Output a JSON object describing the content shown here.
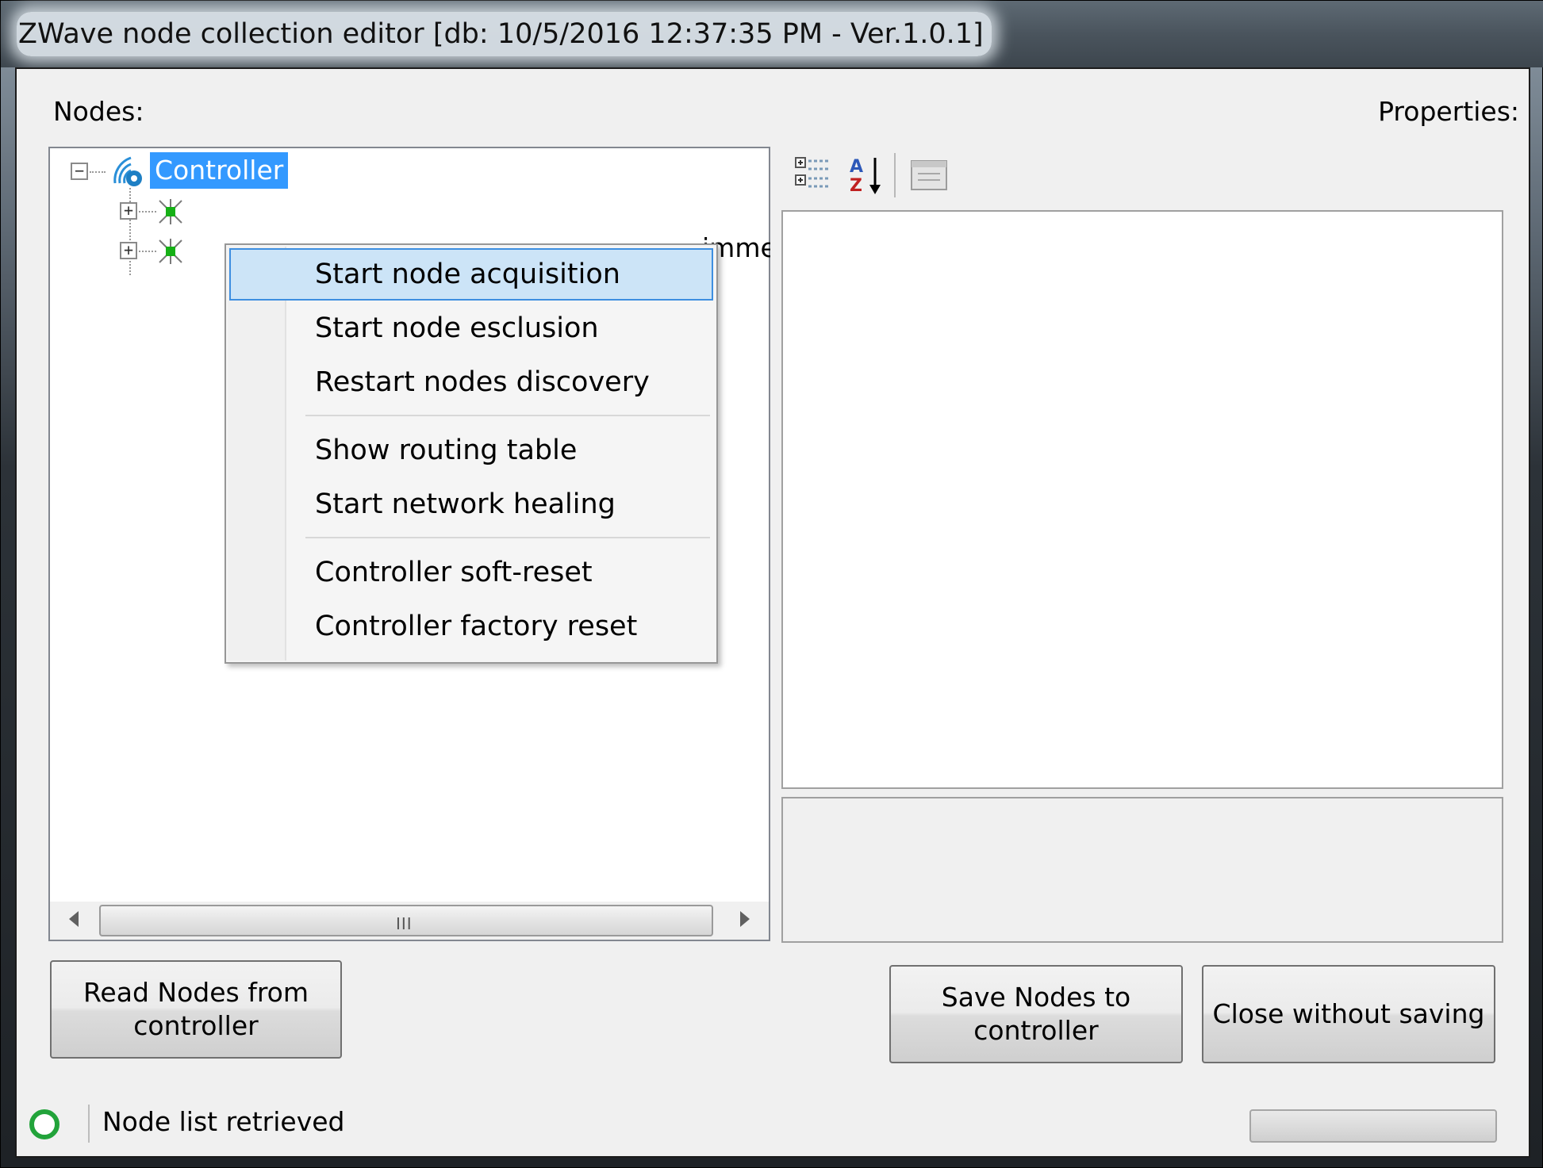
{
  "window": {
    "title": "ZWave node collection editor [db: 10/5/2016 12:37:35 PM - Ver.1.0.1]"
  },
  "nodes_panel": {
    "label": "Nodes:",
    "tree": {
      "root": {
        "label": "Controller",
        "expander": "−",
        "icon": "controller-wireless-icon"
      },
      "children": [
        {
          "expander": "+",
          "icon": "zwave-node-icon"
        },
        {
          "expander": "+",
          "icon": "zwave-node-icon",
          "trailing_text": "immer"
        }
      ]
    },
    "scrollbar_grip": "III"
  },
  "properties_panel": {
    "label": "Properties:",
    "toolbar": [
      {
        "icon": "categorized-view-icon"
      },
      {
        "icon": "alphabetical-sort-icon"
      },
      {
        "icon": "property-pages-icon"
      }
    ]
  },
  "context_menu": {
    "groups": [
      [
        {
          "label": "Start node acquisition",
          "highlighted": true
        },
        {
          "label": "Start node esclusion"
        },
        {
          "label": "Restart nodes discovery"
        }
      ],
      [
        {
          "label": "Show routing table"
        },
        {
          "label": "Start network healing"
        }
      ],
      [
        {
          "label": "Controller soft-reset"
        },
        {
          "label": "Controller factory reset"
        }
      ]
    ]
  },
  "buttons": {
    "read": "Read Nodes from controller",
    "save": "Save Nodes to controller",
    "close": "Close without saving"
  },
  "status_bar": {
    "text": "Node list retrieved",
    "indicator_color": "#22a33a",
    "progress": 0
  },
  "colors": {
    "selection": "#3399ff",
    "menu_highlight": "#cce4f7",
    "menu_highlight_border": "#3d8ee0"
  }
}
